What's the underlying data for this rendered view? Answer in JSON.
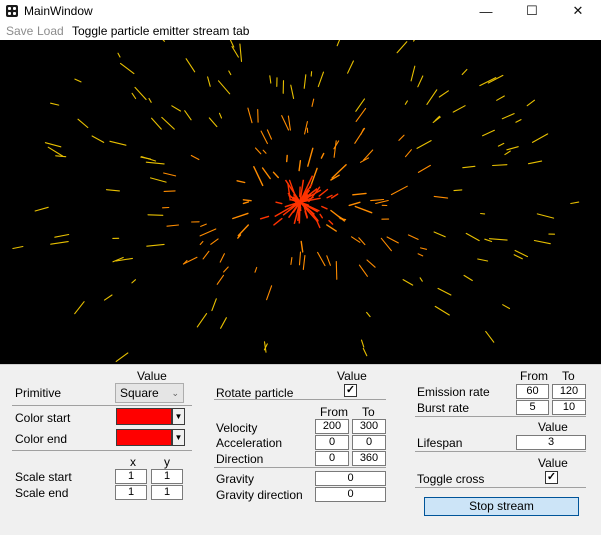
{
  "window": {
    "title": "MainWindow"
  },
  "menu": {
    "save": "Save",
    "load": "Load",
    "toggle_tab": "Toggle particle emitter stream tab"
  },
  "colors": {
    "particle_core": "#ff3300",
    "particle_mid": "#ff8c00",
    "particle_outer": "#e8c000",
    "color_start": "#ff0000",
    "color_end": "#ff0000"
  },
  "primitive": {
    "header": "Value",
    "label": "Primitive",
    "value": "Square"
  },
  "color": {
    "start_label": "Color start",
    "end_label": "Color end"
  },
  "scale": {
    "x_header": "x",
    "y_header": "y",
    "start_label": "Scale start",
    "start_x": "1",
    "start_y": "1",
    "end_label": "Scale end",
    "end_x": "1",
    "end_y": "1"
  },
  "rotate": {
    "header": "Value",
    "label": "Rotate particle",
    "checked": "✓"
  },
  "motion": {
    "from_header": "From",
    "to_header": "To",
    "velocity_label": "Velocity",
    "velocity_from": "200",
    "velocity_to": "300",
    "acceleration_label": "Acceleration",
    "acceleration_from": "0",
    "acceleration_to": "0",
    "direction_label": "Direction",
    "direction_from": "0",
    "direction_to": "360"
  },
  "gravity": {
    "label": "Gravity",
    "value": "0",
    "direction_label": "Gravity direction",
    "direction_value": "0"
  },
  "emission": {
    "from_header": "From",
    "to_header": "To",
    "rate_label": "Emission rate",
    "rate_from": "60",
    "rate_to": "120",
    "burst_label": "Burst rate",
    "burst_from": "5",
    "burst_to": "10"
  },
  "lifespan": {
    "header": "Value",
    "label": "Lifespan",
    "value": "3"
  },
  "cross": {
    "header": "Value",
    "label": "Toggle cross",
    "checked": "✓"
  },
  "stream": {
    "button_label": "Stop stream"
  }
}
